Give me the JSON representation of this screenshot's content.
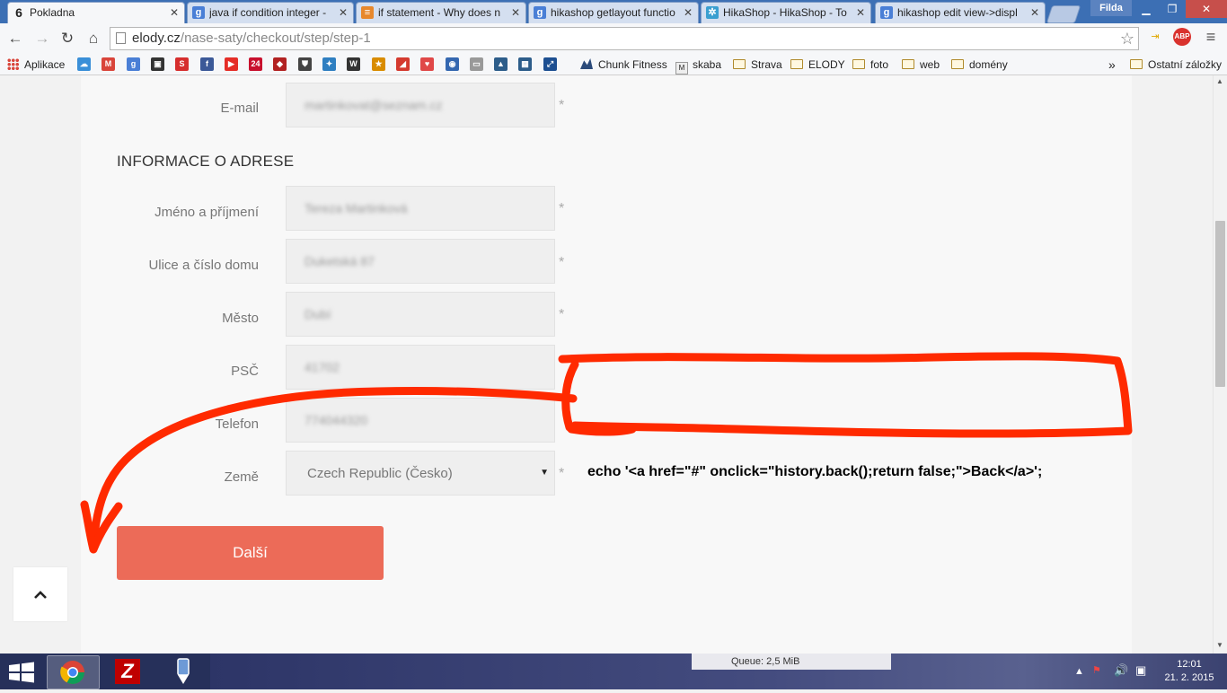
{
  "browser": {
    "tabs": [
      {
        "label": "Pokladna",
        "icon": "elody-favicon",
        "icon_glyph": "6",
        "color": "#222222",
        "active": true
      },
      {
        "label": "java if condition integer -",
        "icon": "google-favicon",
        "icon_glyph": "g",
        "color": "#4a7fd6",
        "active": false
      },
      {
        "label": "if statement - Why does n",
        "icon": "stackoverflow-favicon",
        "icon_glyph": "≡",
        "color": "#e7882d",
        "active": false
      },
      {
        "label": "hikashop getlayout functio",
        "icon": "google-favicon",
        "icon_glyph": "g",
        "color": "#4a7fd6",
        "active": false
      },
      {
        "label": "HikaShop - HikaShop - To",
        "icon": "hikashop-favicon",
        "icon_glyph": "✲",
        "color": "#3a9fd0",
        "active": false
      },
      {
        "label": "hikashop edit view->displ",
        "icon": "google-favicon",
        "icon_glyph": "g",
        "color": "#4a7fd6",
        "active": false
      }
    ],
    "user_name": "Filda",
    "url_domain": "elody.cz",
    "url_path": "/nase-saty/checkout/step/step-1",
    "extensions": [
      {
        "icon": "arrow-device-icon",
        "glyph": "⇥",
        "color": "#e0a800"
      },
      {
        "icon": "adblock-plus-icon",
        "glyph": "ABP",
        "color": "#d9322e"
      },
      {
        "icon": "menu-icon",
        "glyph": "≡",
        "color": "#555555"
      }
    ],
    "bookmarks": {
      "apps_label": "Aplikace",
      "icons": [
        {
          "icon": "weather-bookmark-icon",
          "glyph": "☁",
          "color": "#3a8fd8"
        },
        {
          "icon": "gmail-bookmark-icon",
          "glyph": "M",
          "color": "#d9453b"
        },
        {
          "icon": "google-bookmark-icon",
          "glyph": "g",
          "color": "#4a7fd6"
        },
        {
          "icon": "shopping-bookmark-icon",
          "glyph": "▣",
          "color": "#333333"
        },
        {
          "icon": "seznam-bookmark-icon",
          "glyph": "S",
          "color": "#d62e2e"
        },
        {
          "icon": "facebook-bookmark-icon",
          "glyph": "f",
          "color": "#3b5998"
        },
        {
          "icon": "youtube-bookmark-icon",
          "glyph": "▶",
          "color": "#e52d27"
        },
        {
          "icon": "news24-bookmark-icon",
          "glyph": "24",
          "color": "#c8102e"
        },
        {
          "icon": "bank-bookmark-icon",
          "glyph": "◆",
          "color": "#b22222"
        },
        {
          "icon": "shield-bookmark-icon",
          "glyph": "⛊",
          "color": "#444444"
        },
        {
          "icon": "blue-app-bookmark-icon",
          "glyph": "✦",
          "color": "#2f7fc1"
        },
        {
          "icon": "wikipedia-bookmark-icon",
          "glyph": "W",
          "color": "#333333"
        },
        {
          "icon": "game-bookmark-icon",
          "glyph": "★",
          "color": "#d98c00"
        },
        {
          "icon": "red-app-bookmark-icon",
          "glyph": "◢",
          "color": "#d43a2f"
        },
        {
          "icon": "heart-bookmark-icon",
          "glyph": "♥",
          "color": "#e04848"
        },
        {
          "icon": "circle-bookmark-icon",
          "glyph": "◉",
          "color": "#3467b0"
        },
        {
          "icon": "page-bookmark-icon",
          "glyph": "▭",
          "color": "#999999"
        },
        {
          "icon": "triangle-bookmark-icon",
          "glyph": "▲",
          "color": "#2d5d8a"
        },
        {
          "icon": "grid-bookmark-icon",
          "glyph": "▦",
          "color": "#2d5d8a"
        },
        {
          "icon": "chart-bookmark-icon",
          "glyph": "⤢",
          "color": "#1d4f91"
        }
      ],
      "items": [
        "Chunk Fitness",
        "skaba"
      ],
      "folders": [
        "Strava",
        "ELODY",
        "foto",
        "web",
        "domény"
      ],
      "more": "»",
      "other": "Ostatní záložky"
    }
  },
  "page": {
    "email_label": "E-mail",
    "email_value": "martinkovat@seznam.cz",
    "section_title": "INFORMACE O ADRESE",
    "fields": [
      {
        "label": "Jméno a příjmení",
        "value": "Tereza Martinková"
      },
      {
        "label": "Ulice a číslo domu",
        "value": "Duketská 87"
      },
      {
        "label": "Město",
        "value": "Dubí"
      },
      {
        "label": "PSČ",
        "value": "41702"
      },
      {
        "label": "Telefon",
        "value": "774044320"
      }
    ],
    "country_label": "Země",
    "country_value": "Czech Republic (Česko)",
    "required_mark": "*",
    "submit_label": "Další",
    "scroll_top_icon": "chevron-up-icon"
  },
  "annotation": {
    "code": "echo '<a href=\"#\"  onclick=\"history.back();return false;\">Back</a>';",
    "color": "#ff2a00"
  },
  "taskbar": {
    "filezilla_queue": "Queue: 2,5 MiB",
    "time": "12:01",
    "date": "21. 2. 2015"
  }
}
